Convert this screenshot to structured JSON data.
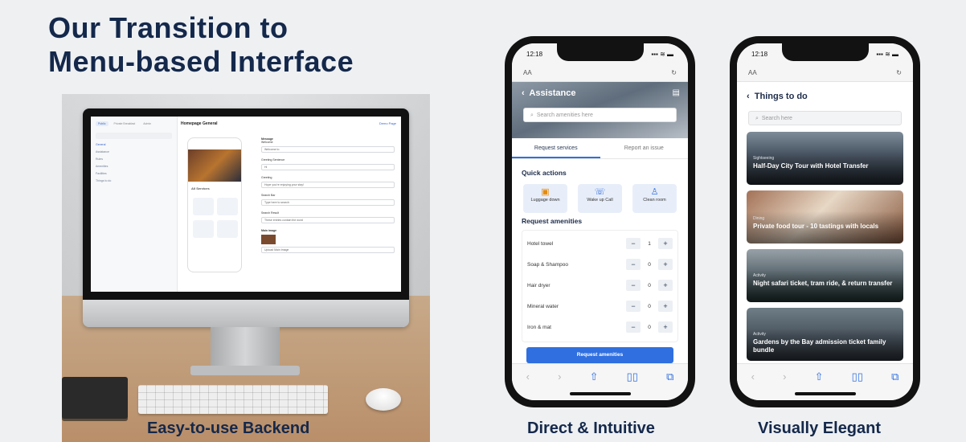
{
  "title_line1": "Our Transition to",
  "title_line2": "Menu-based Interface",
  "captions": {
    "backend": "Easy-to-use Backend",
    "direct": "Direct & Intuitive",
    "elegant": "Visually Elegant"
  },
  "backend": {
    "tabs": [
      "Public",
      "Private Breakfast",
      "Admin"
    ],
    "sidebar_items": [
      "General",
      "Assistance",
      "Rules",
      "Amenities",
      "Facilities",
      "Things to do"
    ],
    "heading": "Homepage General",
    "preview_link": "Demo Page",
    "form": [
      {
        "label": "Welcome",
        "value": "Welcome to"
      },
      {
        "label": "Greeting Sentence",
        "value": "Hi"
      },
      {
        "label": "Greeting",
        "value": "Hope you're enjoying your stay!"
      },
      {
        "label": "Search Bar",
        "value": "Type here to search"
      },
      {
        "label": "Search Result",
        "value": "These entries contain the word"
      }
    ],
    "section_message": "Message",
    "all_services": "All Services",
    "main_image": "Main image",
    "upload_label": "Upload Main Image"
  },
  "phone1": {
    "time": "12:18",
    "signal": "▪▪▪ ≋ ▬",
    "aa": "AA",
    "reload": "↻",
    "back": "‹",
    "screen_title": "Assistance",
    "search_placeholder": "Search amenities here",
    "tab_request": "Request services",
    "tab_report": "Report an issue",
    "quick_actions_title": "Quick actions",
    "quick_actions": [
      {
        "label": "Luggage down",
        "icon": "▣"
      },
      {
        "label": "Wake up Call",
        "icon": "☏"
      },
      {
        "label": "Clean room",
        "icon": "♙"
      }
    ],
    "amenities_title": "Request amenities",
    "amenities": [
      {
        "name": "Hotel towel",
        "qty": "1"
      },
      {
        "name": "Soap & Shampoo",
        "qty": "0"
      },
      {
        "name": "Hair dryer",
        "qty": "0"
      },
      {
        "name": "Mineral water",
        "qty": "0"
      },
      {
        "name": "Iron & mat",
        "qty": "0"
      }
    ],
    "minus": "−",
    "plus": "+",
    "cta": "Request amenities"
  },
  "phone2": {
    "time": "12:18",
    "signal": "▪▪▪ ≋ ▬",
    "aa": "AA",
    "reload": "↻",
    "back": "‹",
    "screen_title": "Things to do",
    "search_placeholder": "Search here",
    "cards": [
      {
        "tag": "Sightseeing",
        "title": "Half-Day City Tour with Hotel Transfer"
      },
      {
        "tag": "Dining",
        "title": "Private food tour - 10 tastings with locals"
      },
      {
        "tag": "Activity",
        "title": "Night safari ticket, tram ride, & return transfer"
      },
      {
        "tag": "Activity",
        "title": "Gardens by the Bay admission ticket family bundle"
      }
    ]
  },
  "browser_icons": {
    "back": "‹",
    "forward": "›",
    "share": "⇧",
    "book": "▯▯",
    "tabs": "⧉"
  }
}
